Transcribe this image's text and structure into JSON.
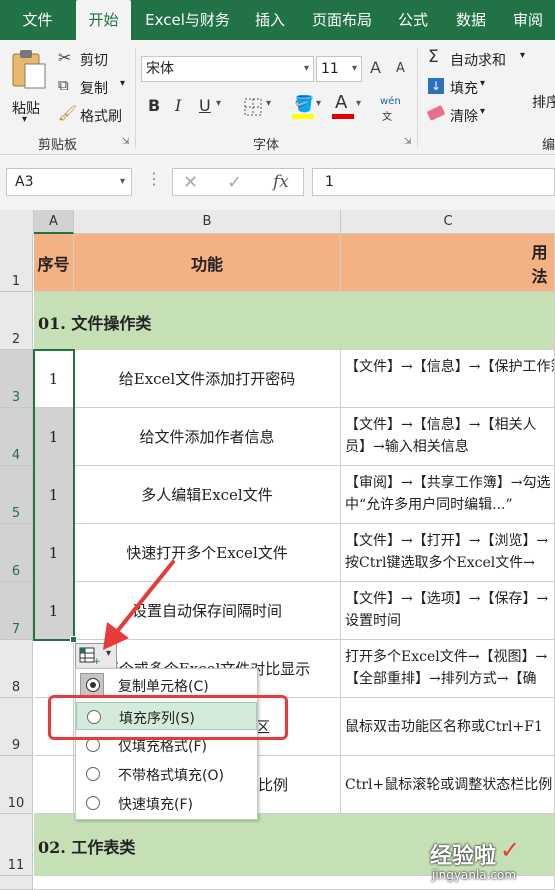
{
  "tabs": [
    "文件",
    "开始",
    "Excel与财务",
    "插入",
    "页面布局",
    "公式",
    "数据",
    "审阅"
  ],
  "ribbon": {
    "clipboard": {
      "paste": "粘贴",
      "cut": "剪切",
      "copy": "复制",
      "format_painter": "格式刷",
      "group": "剪贴板"
    },
    "font": {
      "name": "宋体",
      "size": "11",
      "bold": "B",
      "italic": "I",
      "underline": "U",
      "grow": "A",
      "shrink": "A",
      "phonetic": "wén",
      "group": "字体"
    },
    "editing": {
      "autosum": "自动求和",
      "fill": "填充",
      "clear": "清除",
      "sort": "排序",
      "group": "编"
    }
  },
  "formula_bar": {
    "name_box": "A3",
    "fx": "fx",
    "value": "1"
  },
  "columns": [
    "A",
    "B",
    "C"
  ],
  "rows": [
    {
      "num": "1",
      "a": "序号",
      "b": "功能",
      "c": "用法"
    },
    {
      "num": "2",
      "section": "01. 文件操作类"
    },
    {
      "num": "3",
      "a": "1",
      "b": "给Excel文件添加打开密码",
      "c": "【文件】→【信息】→【保护工作簿】→【用密码进行加密】"
    },
    {
      "num": "4",
      "a": "1",
      "b": "给文件添加作者信息",
      "c": "【文件】→【信息】→【相关人员】→输入相关信息"
    },
    {
      "num": "5",
      "a": "1",
      "b": "多人编辑Excel文件",
      "c": "【审阅】→【共享工作簿】→勾选中“允许多用户同时编辑...”"
    },
    {
      "num": "6",
      "a": "1",
      "b": "快速打开多个Excel文件",
      "c": "【文件】→【打开】→【浏览】→按Ctrl键选取多个Excel文件→【打开】"
    },
    {
      "num": "7",
      "a": "1",
      "b": "设置自动保存间隔时间",
      "c": "【文件】→【选项】→【保存】→设置时间"
    },
    {
      "num": "8",
      "a": "",
      "b": "两个或多个Excel文件对比显示",
      "c": "打开多个Excel文件→【视图】→【全部重排】→排列方式→【确定】"
    },
    {
      "num": "9",
      "a": "",
      "b": "最小化功能区",
      "c": "鼠标双击功能区名称或Ctrl+F1"
    },
    {
      "num": "10",
      "a": "",
      "b": "调整显示比例",
      "c": "Ctrl+鼠标滚轮或调整状态栏比例"
    },
    {
      "num": "11",
      "section": "02. 工作表类"
    }
  ],
  "autofill_menu": [
    {
      "label": "复制单元格(C)",
      "checked": true
    },
    {
      "label": "填充序列(S)",
      "checked": false,
      "highlighted": true
    },
    {
      "label": "仅填充格式(F)",
      "checked": false
    },
    {
      "label": "不带格式填充(O)",
      "checked": false
    },
    {
      "label": "快速填充(F)",
      "checked": false
    }
  ],
  "watermark": {
    "text": "经验啦",
    "url": "jingyanla.com"
  },
  "colors": {
    "excel_green": "#217346",
    "header_fill": "#f4b183",
    "section_fill": "#c5e0b4",
    "highlight_red": "#e83a3a"
  }
}
